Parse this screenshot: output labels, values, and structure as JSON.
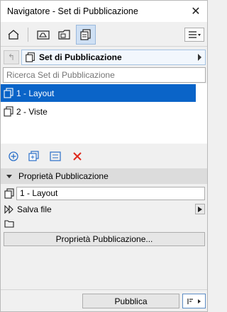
{
  "window": {
    "title": "Navigatore - Set di Pubblicazione"
  },
  "toolbar": {
    "buttons": [
      {
        "icon": "project-map-icon"
      },
      {
        "icon": "view-map-icon"
      },
      {
        "icon": "layout-book-icon"
      },
      {
        "icon": "publisher-sets-icon",
        "active": true
      }
    ],
    "menu_icon": "hamburger-menu-icon"
  },
  "set_selector": {
    "label": "Set di Pubblicazione",
    "up_icon": "up-level-icon"
  },
  "search": {
    "placeholder": "Ricerca Set di Pubblicazione",
    "value": ""
  },
  "list": {
    "items": [
      {
        "label": "1 - Layout",
        "selected": true
      },
      {
        "label": "2 - Viste",
        "selected": false
      }
    ]
  },
  "actions": [
    "add-circle-icon",
    "new-folder-icon",
    "list-settings-icon",
    "delete-x-icon"
  ],
  "properties": {
    "header": "Proprietà Pubblicazione",
    "item_name": "1 - Layout",
    "save_mode": "Salva file",
    "button_label": "Proprietà Pubblicazione..."
  },
  "footer": {
    "publish_label": "Pubblica"
  },
  "colors": {
    "selection": "#0a64c8",
    "active_tab": "#cfe0f4",
    "delete": "#e0291c"
  }
}
